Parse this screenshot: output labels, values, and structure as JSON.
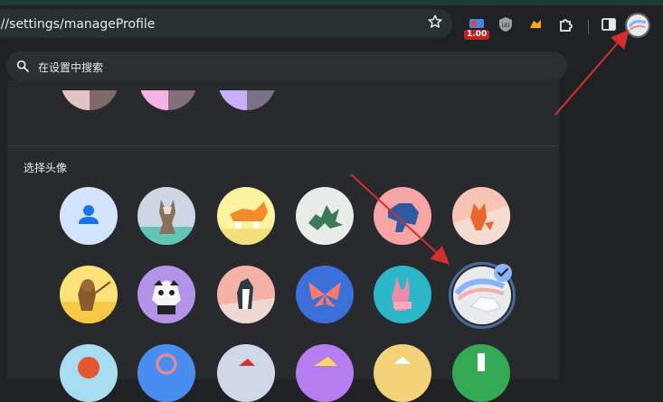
{
  "toolbar": {
    "url": "://settings/manageProfile",
    "bookmark_icon": "star-icon",
    "extension_badge": "1.00",
    "extensions": [
      "tag-extension-icon",
      "ublock-shield-icon",
      "duck-extension-icon",
      "puzzle-extensions-icon"
    ],
    "side_panel_icon": "side-panel-icon",
    "profile_icon": "profile-avatar-icon"
  },
  "search": {
    "placeholder": "在设置中搜索"
  },
  "avatar_section": {
    "title": "选择头像",
    "selected": "unicorn",
    "avatars": [
      "generic-person",
      "origami-cat",
      "origami-corgi",
      "origami-dragon",
      "origami-elephant",
      "origami-fox",
      "origami-monkey",
      "origami-panda",
      "origami-penguin",
      "origami-butterfly",
      "origami-rabbit",
      "origami-unicorn",
      "basketball",
      "bicycle",
      "bird",
      "cheese",
      "football",
      "sunglasses"
    ]
  },
  "colors": {
    "background": "#202124",
    "panel": "#292a2d",
    "accent": "#8ab4f8",
    "annotation_arrow": "#d32f2f"
  }
}
